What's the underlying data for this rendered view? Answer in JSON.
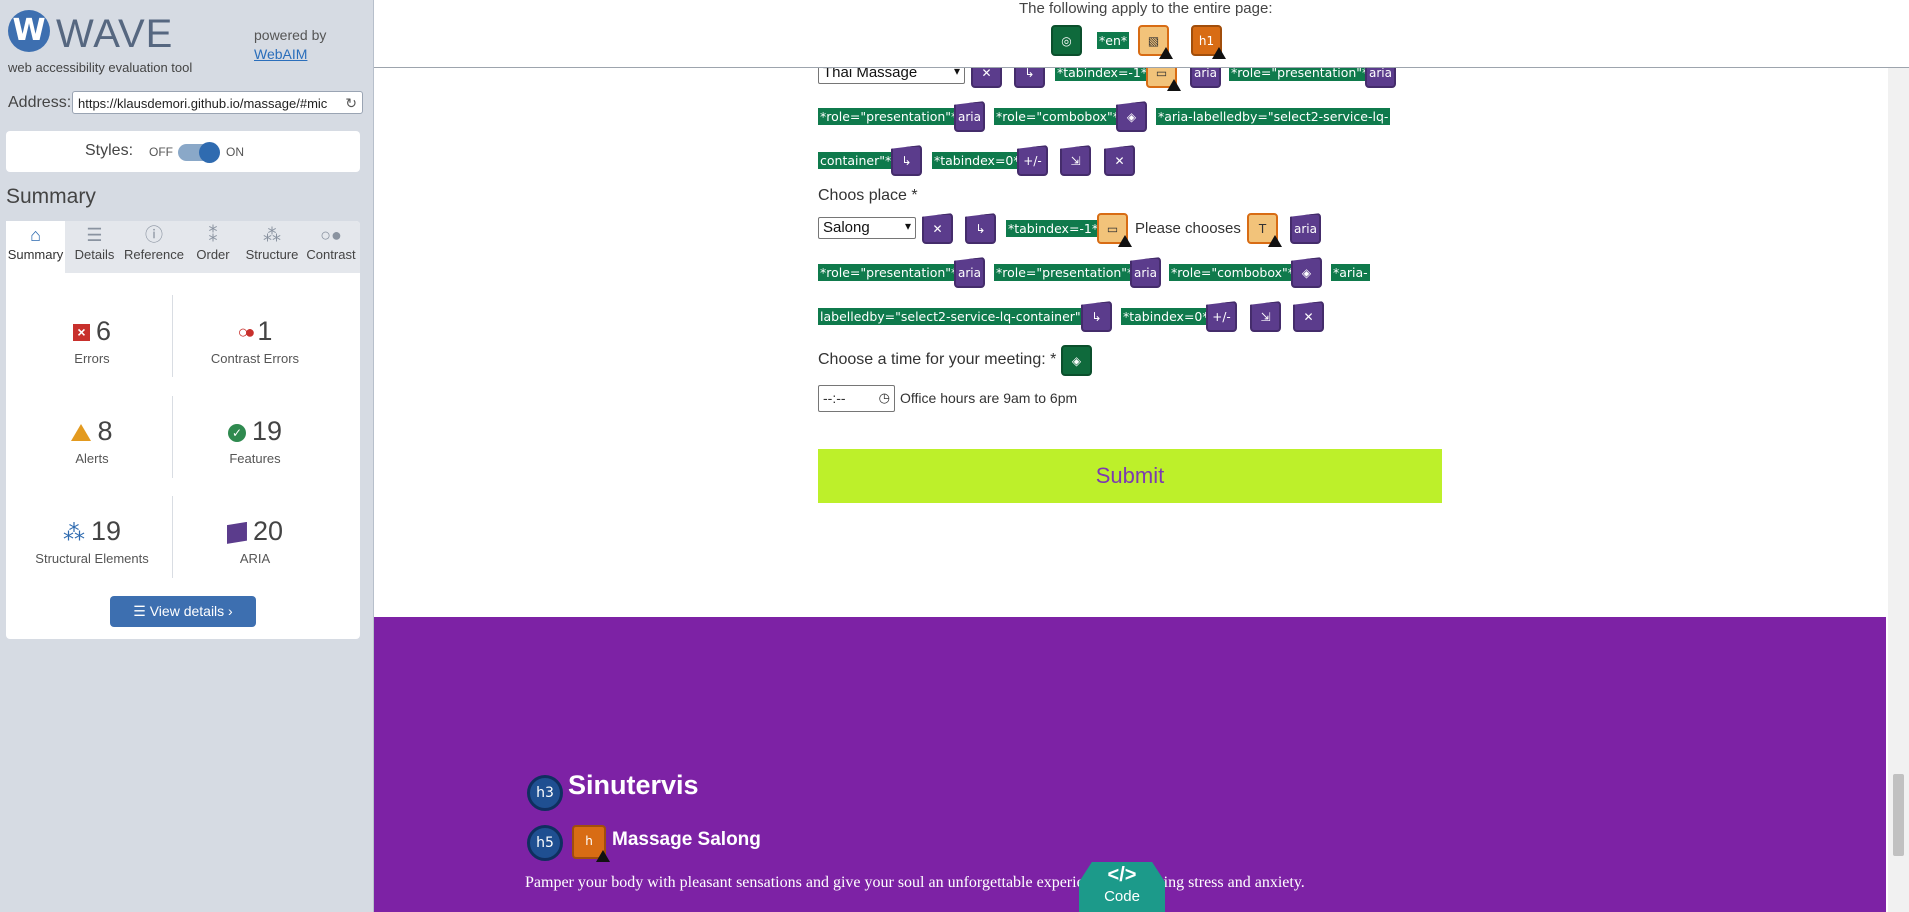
{
  "wave": {
    "logo": "WAVE",
    "tagline": "web accessibility evaluation tool",
    "powered_by": "powered by",
    "webaim": "WebAIM",
    "address_label": "Address:",
    "address_value": "https://klausdemori.github.io/massage/#mic",
    "styles_label": "Styles:",
    "styles_off": "OFF",
    "styles_on": "ON",
    "summary_heading": "Summary",
    "tabs": [
      {
        "label": "Summary",
        "icon": "home-icon"
      },
      {
        "label": "Details",
        "icon": "list-icon"
      },
      {
        "label": "Reference",
        "icon": "info-icon"
      },
      {
        "label": "Order",
        "icon": "order-icon"
      },
      {
        "label": "Structure",
        "icon": "structure-icon"
      },
      {
        "label": "Contrast",
        "icon": "contrast-icon"
      }
    ],
    "stats": {
      "errors": {
        "count": "6",
        "label": "Errors"
      },
      "contrast": {
        "count": "1",
        "label": "Contrast Errors"
      },
      "alerts": {
        "count": "8",
        "label": "Alerts"
      },
      "features": {
        "count": "19",
        "label": "Features"
      },
      "structural": {
        "count": "19",
        "label": "Structural Elements"
      },
      "aria": {
        "count": "20",
        "label": "ARIA"
      }
    },
    "view_details": "View details ›"
  },
  "page": {
    "apply_text": "The following apply to the entire page:",
    "apply_icons": {
      "lang": "*en*",
      "h1": "h1"
    },
    "service_select": "Thai Massage",
    "tags_row1": [
      "*tabindex=-1*",
      "*role=\"presentation\"*"
    ],
    "tags_row2": [
      "*role=\"presentation\"*",
      "*role=\"combobox\"*",
      "*aria-labelledby=\"select2-service-lq-"
    ],
    "tags_row3": [
      "container\"*",
      "*tabindex=0*"
    ],
    "place_label": "Choos place *",
    "place_select": "Salong",
    "place_tags_row1": [
      "*tabindex=-1*"
    ],
    "please_choose": "Please chooses",
    "place_tags_row2": [
      "*role=\"presentation\"*",
      "*role=\"presentation\"*",
      "*role=\"combobox\"*",
      "*aria-"
    ],
    "place_tags_row3": [
      "labelledby=\"select2-service-lq-container\"*",
      "*tabindex=0*"
    ],
    "aria_text": "aria",
    "plusminus": "+/-",
    "time_label": "Choose a time for your meeting: *",
    "time_value": "--:--",
    "office_hours": "Office hours are 9am to 6pm",
    "submit": "Submit",
    "footer": {
      "h3_badge": "h3",
      "h3": "Sinutervis",
      "h5_badge": "h5",
      "h5": "Massage Salong",
      "text": "Pamper your body with pleasant sensations and give your soul an unforgettable experience of relieving stress and anxiety."
    },
    "code_button": "Code",
    "colors": {
      "footer_bg": "#7d22a5",
      "submit_bg": "#bdf02a",
      "submit_text": "#7d3ab0"
    }
  }
}
